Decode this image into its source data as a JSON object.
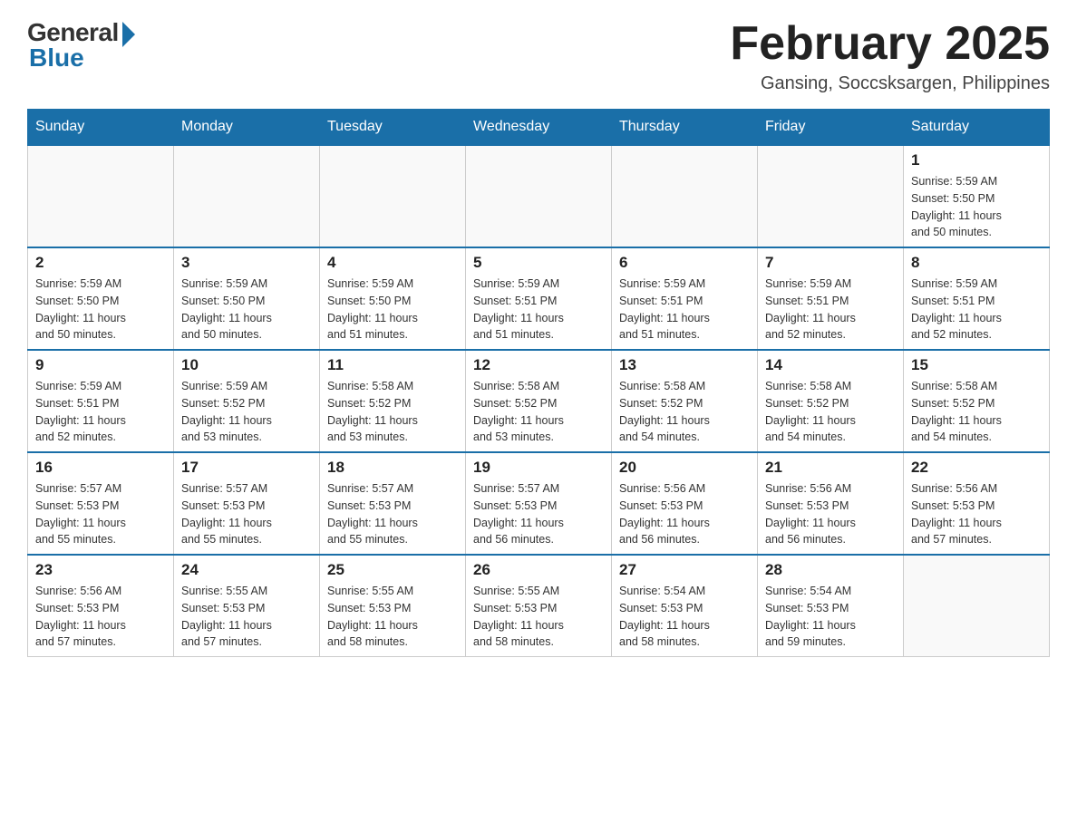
{
  "header": {
    "logo_general": "General",
    "logo_blue": "Blue",
    "month_year": "February 2025",
    "location": "Gansing, Soccsksargen, Philippines"
  },
  "weekdays": [
    "Sunday",
    "Monday",
    "Tuesday",
    "Wednesday",
    "Thursday",
    "Friday",
    "Saturday"
  ],
  "weeks": [
    [
      {
        "day": "",
        "info": ""
      },
      {
        "day": "",
        "info": ""
      },
      {
        "day": "",
        "info": ""
      },
      {
        "day": "",
        "info": ""
      },
      {
        "day": "",
        "info": ""
      },
      {
        "day": "",
        "info": ""
      },
      {
        "day": "1",
        "info": "Sunrise: 5:59 AM\nSunset: 5:50 PM\nDaylight: 11 hours\nand 50 minutes."
      }
    ],
    [
      {
        "day": "2",
        "info": "Sunrise: 5:59 AM\nSunset: 5:50 PM\nDaylight: 11 hours\nand 50 minutes."
      },
      {
        "day": "3",
        "info": "Sunrise: 5:59 AM\nSunset: 5:50 PM\nDaylight: 11 hours\nand 50 minutes."
      },
      {
        "day": "4",
        "info": "Sunrise: 5:59 AM\nSunset: 5:50 PM\nDaylight: 11 hours\nand 51 minutes."
      },
      {
        "day": "5",
        "info": "Sunrise: 5:59 AM\nSunset: 5:51 PM\nDaylight: 11 hours\nand 51 minutes."
      },
      {
        "day": "6",
        "info": "Sunrise: 5:59 AM\nSunset: 5:51 PM\nDaylight: 11 hours\nand 51 minutes."
      },
      {
        "day": "7",
        "info": "Sunrise: 5:59 AM\nSunset: 5:51 PM\nDaylight: 11 hours\nand 52 minutes."
      },
      {
        "day": "8",
        "info": "Sunrise: 5:59 AM\nSunset: 5:51 PM\nDaylight: 11 hours\nand 52 minutes."
      }
    ],
    [
      {
        "day": "9",
        "info": "Sunrise: 5:59 AM\nSunset: 5:51 PM\nDaylight: 11 hours\nand 52 minutes."
      },
      {
        "day": "10",
        "info": "Sunrise: 5:59 AM\nSunset: 5:52 PM\nDaylight: 11 hours\nand 53 minutes."
      },
      {
        "day": "11",
        "info": "Sunrise: 5:58 AM\nSunset: 5:52 PM\nDaylight: 11 hours\nand 53 minutes."
      },
      {
        "day": "12",
        "info": "Sunrise: 5:58 AM\nSunset: 5:52 PM\nDaylight: 11 hours\nand 53 minutes."
      },
      {
        "day": "13",
        "info": "Sunrise: 5:58 AM\nSunset: 5:52 PM\nDaylight: 11 hours\nand 54 minutes."
      },
      {
        "day": "14",
        "info": "Sunrise: 5:58 AM\nSunset: 5:52 PM\nDaylight: 11 hours\nand 54 minutes."
      },
      {
        "day": "15",
        "info": "Sunrise: 5:58 AM\nSunset: 5:52 PM\nDaylight: 11 hours\nand 54 minutes."
      }
    ],
    [
      {
        "day": "16",
        "info": "Sunrise: 5:57 AM\nSunset: 5:53 PM\nDaylight: 11 hours\nand 55 minutes."
      },
      {
        "day": "17",
        "info": "Sunrise: 5:57 AM\nSunset: 5:53 PM\nDaylight: 11 hours\nand 55 minutes."
      },
      {
        "day": "18",
        "info": "Sunrise: 5:57 AM\nSunset: 5:53 PM\nDaylight: 11 hours\nand 55 minutes."
      },
      {
        "day": "19",
        "info": "Sunrise: 5:57 AM\nSunset: 5:53 PM\nDaylight: 11 hours\nand 56 minutes."
      },
      {
        "day": "20",
        "info": "Sunrise: 5:56 AM\nSunset: 5:53 PM\nDaylight: 11 hours\nand 56 minutes."
      },
      {
        "day": "21",
        "info": "Sunrise: 5:56 AM\nSunset: 5:53 PM\nDaylight: 11 hours\nand 56 minutes."
      },
      {
        "day": "22",
        "info": "Sunrise: 5:56 AM\nSunset: 5:53 PM\nDaylight: 11 hours\nand 57 minutes."
      }
    ],
    [
      {
        "day": "23",
        "info": "Sunrise: 5:56 AM\nSunset: 5:53 PM\nDaylight: 11 hours\nand 57 minutes."
      },
      {
        "day": "24",
        "info": "Sunrise: 5:55 AM\nSunset: 5:53 PM\nDaylight: 11 hours\nand 57 minutes."
      },
      {
        "day": "25",
        "info": "Sunrise: 5:55 AM\nSunset: 5:53 PM\nDaylight: 11 hours\nand 58 minutes."
      },
      {
        "day": "26",
        "info": "Sunrise: 5:55 AM\nSunset: 5:53 PM\nDaylight: 11 hours\nand 58 minutes."
      },
      {
        "day": "27",
        "info": "Sunrise: 5:54 AM\nSunset: 5:53 PM\nDaylight: 11 hours\nand 58 minutes."
      },
      {
        "day": "28",
        "info": "Sunrise: 5:54 AM\nSunset: 5:53 PM\nDaylight: 11 hours\nand 59 minutes."
      },
      {
        "day": "",
        "info": ""
      }
    ]
  ]
}
